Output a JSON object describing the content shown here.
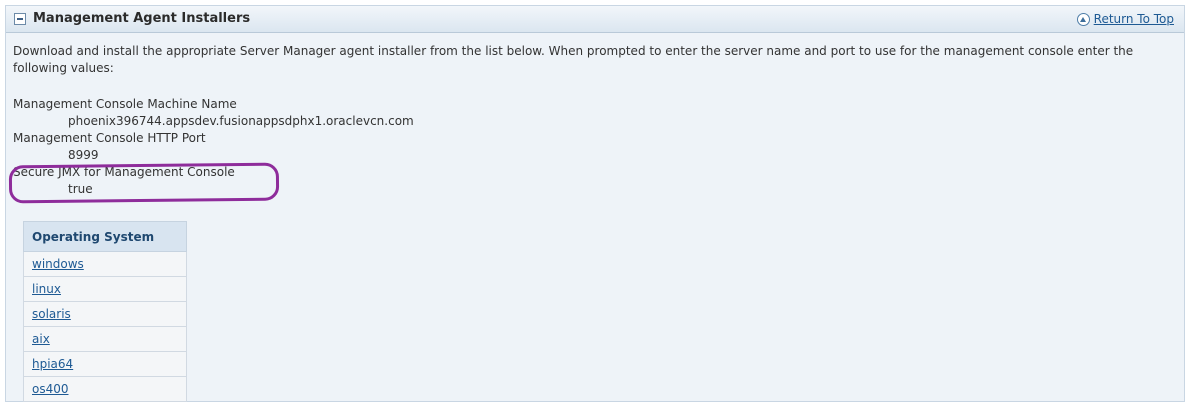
{
  "section": {
    "title": "Management Agent Installers",
    "return_to_top": "Return To Top"
  },
  "intro_text": "Download and install the appropriate Server Manager agent installer from the list below. When prompted to enter the server name and port to use for the management console enter the following values:",
  "fields": [
    {
      "label": "Management Console Machine Name",
      "value": "phoenix396744.appsdev.fusionappsdphx1.oraclevcn.com"
    },
    {
      "label": "Management Console HTTP Port",
      "value": "8999"
    },
    {
      "label": "Secure JMX for Management Console",
      "value": "true"
    }
  ],
  "os_table": {
    "header": "Operating System",
    "rows": [
      "windows",
      "linux",
      "solaris",
      "aix",
      "hpia64",
      "os400"
    ]
  },
  "colors": {
    "highlight": "#8e2c9b",
    "link": "#1e5a94",
    "panel_bg": "#eef3f8"
  },
  "icons": {
    "collapse": "minus-box-icon",
    "return_top": "chevron-up-circle-icon"
  }
}
